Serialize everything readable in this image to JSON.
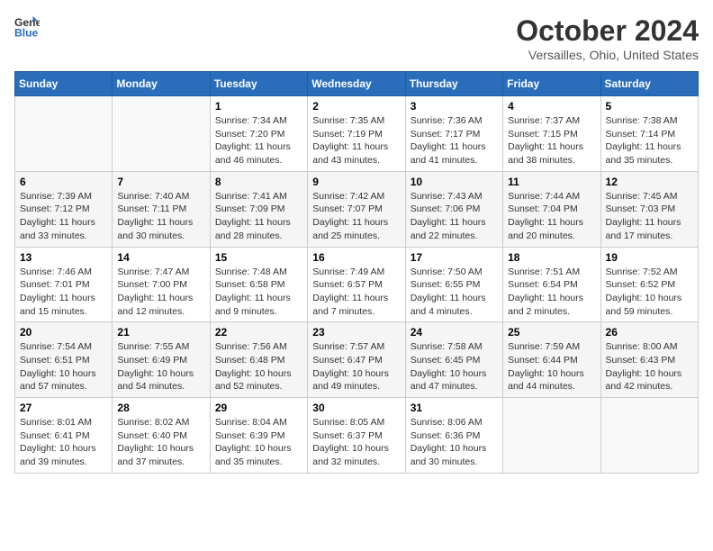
{
  "header": {
    "logo_line1": "General",
    "logo_line2": "Blue",
    "month": "October 2024",
    "location": "Versailles, Ohio, United States"
  },
  "weekdays": [
    "Sunday",
    "Monday",
    "Tuesday",
    "Wednesday",
    "Thursday",
    "Friday",
    "Saturday"
  ],
  "weeks": [
    [
      {
        "day": "",
        "sunrise": "",
        "sunset": "",
        "daylight": ""
      },
      {
        "day": "",
        "sunrise": "",
        "sunset": "",
        "daylight": ""
      },
      {
        "day": "1",
        "sunrise": "Sunrise: 7:34 AM",
        "sunset": "Sunset: 7:20 PM",
        "daylight": "Daylight: 11 hours and 46 minutes."
      },
      {
        "day": "2",
        "sunrise": "Sunrise: 7:35 AM",
        "sunset": "Sunset: 7:19 PM",
        "daylight": "Daylight: 11 hours and 43 minutes."
      },
      {
        "day": "3",
        "sunrise": "Sunrise: 7:36 AM",
        "sunset": "Sunset: 7:17 PM",
        "daylight": "Daylight: 11 hours and 41 minutes."
      },
      {
        "day": "4",
        "sunrise": "Sunrise: 7:37 AM",
        "sunset": "Sunset: 7:15 PM",
        "daylight": "Daylight: 11 hours and 38 minutes."
      },
      {
        "day": "5",
        "sunrise": "Sunrise: 7:38 AM",
        "sunset": "Sunset: 7:14 PM",
        "daylight": "Daylight: 11 hours and 35 minutes."
      }
    ],
    [
      {
        "day": "6",
        "sunrise": "Sunrise: 7:39 AM",
        "sunset": "Sunset: 7:12 PM",
        "daylight": "Daylight: 11 hours and 33 minutes."
      },
      {
        "day": "7",
        "sunrise": "Sunrise: 7:40 AM",
        "sunset": "Sunset: 7:11 PM",
        "daylight": "Daylight: 11 hours and 30 minutes."
      },
      {
        "day": "8",
        "sunrise": "Sunrise: 7:41 AM",
        "sunset": "Sunset: 7:09 PM",
        "daylight": "Daylight: 11 hours and 28 minutes."
      },
      {
        "day": "9",
        "sunrise": "Sunrise: 7:42 AM",
        "sunset": "Sunset: 7:07 PM",
        "daylight": "Daylight: 11 hours and 25 minutes."
      },
      {
        "day": "10",
        "sunrise": "Sunrise: 7:43 AM",
        "sunset": "Sunset: 7:06 PM",
        "daylight": "Daylight: 11 hours and 22 minutes."
      },
      {
        "day": "11",
        "sunrise": "Sunrise: 7:44 AM",
        "sunset": "Sunset: 7:04 PM",
        "daylight": "Daylight: 11 hours and 20 minutes."
      },
      {
        "day": "12",
        "sunrise": "Sunrise: 7:45 AM",
        "sunset": "Sunset: 7:03 PM",
        "daylight": "Daylight: 11 hours and 17 minutes."
      }
    ],
    [
      {
        "day": "13",
        "sunrise": "Sunrise: 7:46 AM",
        "sunset": "Sunset: 7:01 PM",
        "daylight": "Daylight: 11 hours and 15 minutes."
      },
      {
        "day": "14",
        "sunrise": "Sunrise: 7:47 AM",
        "sunset": "Sunset: 7:00 PM",
        "daylight": "Daylight: 11 hours and 12 minutes."
      },
      {
        "day": "15",
        "sunrise": "Sunrise: 7:48 AM",
        "sunset": "Sunset: 6:58 PM",
        "daylight": "Daylight: 11 hours and 9 minutes."
      },
      {
        "day": "16",
        "sunrise": "Sunrise: 7:49 AM",
        "sunset": "Sunset: 6:57 PM",
        "daylight": "Daylight: 11 hours and 7 minutes."
      },
      {
        "day": "17",
        "sunrise": "Sunrise: 7:50 AM",
        "sunset": "Sunset: 6:55 PM",
        "daylight": "Daylight: 11 hours and 4 minutes."
      },
      {
        "day": "18",
        "sunrise": "Sunrise: 7:51 AM",
        "sunset": "Sunset: 6:54 PM",
        "daylight": "Daylight: 11 hours and 2 minutes."
      },
      {
        "day": "19",
        "sunrise": "Sunrise: 7:52 AM",
        "sunset": "Sunset: 6:52 PM",
        "daylight": "Daylight: 10 hours and 59 minutes."
      }
    ],
    [
      {
        "day": "20",
        "sunrise": "Sunrise: 7:54 AM",
        "sunset": "Sunset: 6:51 PM",
        "daylight": "Daylight: 10 hours and 57 minutes."
      },
      {
        "day": "21",
        "sunrise": "Sunrise: 7:55 AM",
        "sunset": "Sunset: 6:49 PM",
        "daylight": "Daylight: 10 hours and 54 minutes."
      },
      {
        "day": "22",
        "sunrise": "Sunrise: 7:56 AM",
        "sunset": "Sunset: 6:48 PM",
        "daylight": "Daylight: 10 hours and 52 minutes."
      },
      {
        "day": "23",
        "sunrise": "Sunrise: 7:57 AM",
        "sunset": "Sunset: 6:47 PM",
        "daylight": "Daylight: 10 hours and 49 minutes."
      },
      {
        "day": "24",
        "sunrise": "Sunrise: 7:58 AM",
        "sunset": "Sunset: 6:45 PM",
        "daylight": "Daylight: 10 hours and 47 minutes."
      },
      {
        "day": "25",
        "sunrise": "Sunrise: 7:59 AM",
        "sunset": "Sunset: 6:44 PM",
        "daylight": "Daylight: 10 hours and 44 minutes."
      },
      {
        "day": "26",
        "sunrise": "Sunrise: 8:00 AM",
        "sunset": "Sunset: 6:43 PM",
        "daylight": "Daylight: 10 hours and 42 minutes."
      }
    ],
    [
      {
        "day": "27",
        "sunrise": "Sunrise: 8:01 AM",
        "sunset": "Sunset: 6:41 PM",
        "daylight": "Daylight: 10 hours and 39 minutes."
      },
      {
        "day": "28",
        "sunrise": "Sunrise: 8:02 AM",
        "sunset": "Sunset: 6:40 PM",
        "daylight": "Daylight: 10 hours and 37 minutes."
      },
      {
        "day": "29",
        "sunrise": "Sunrise: 8:04 AM",
        "sunset": "Sunset: 6:39 PM",
        "daylight": "Daylight: 10 hours and 35 minutes."
      },
      {
        "day": "30",
        "sunrise": "Sunrise: 8:05 AM",
        "sunset": "Sunset: 6:37 PM",
        "daylight": "Daylight: 10 hours and 32 minutes."
      },
      {
        "day": "31",
        "sunrise": "Sunrise: 8:06 AM",
        "sunset": "Sunset: 6:36 PM",
        "daylight": "Daylight: 10 hours and 30 minutes."
      },
      {
        "day": "",
        "sunrise": "",
        "sunset": "",
        "daylight": ""
      },
      {
        "day": "",
        "sunrise": "",
        "sunset": "",
        "daylight": ""
      }
    ]
  ]
}
